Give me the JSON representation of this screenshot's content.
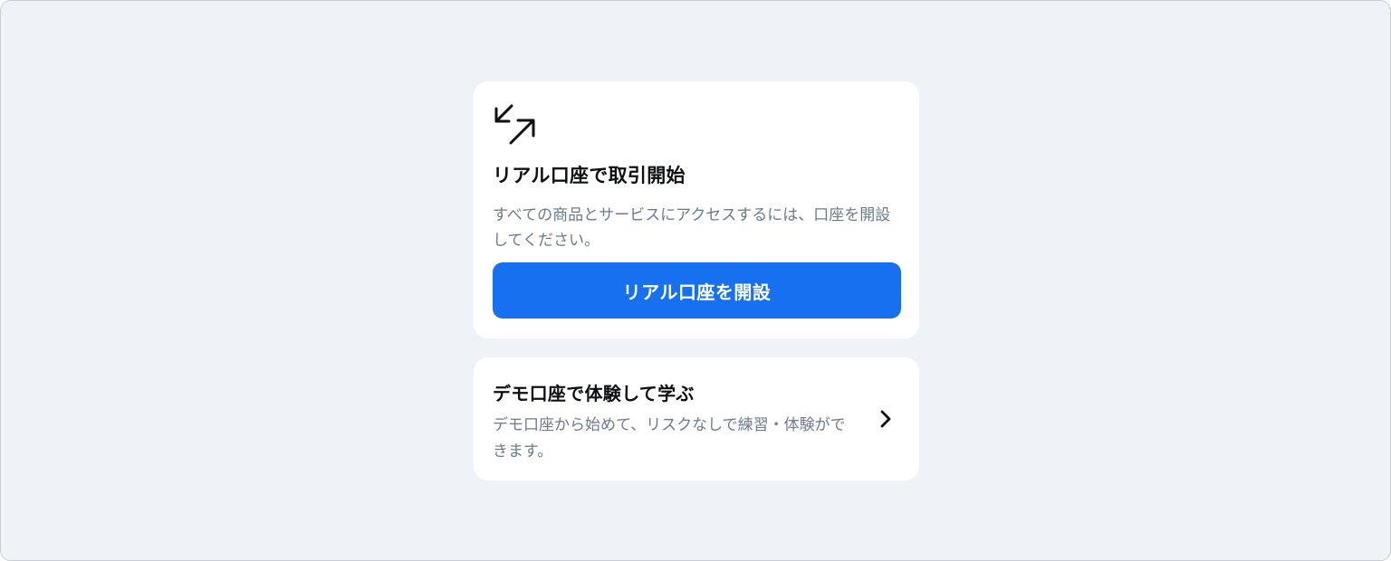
{
  "real_account": {
    "icon": "arrows-exchange-icon",
    "title": "リアル口座で取引開始",
    "description": "すべての商品とサービスにアクセスするには、口座を開設してください。",
    "button_label": "リアル口座を開設",
    "button_color": "#1670f0"
  },
  "demo_account": {
    "title": "デモ口座で体験して学ぶ",
    "description": "デモ口座から始めて、リスクなしで練習・体験ができます。",
    "icon": "chevron-right-icon"
  },
  "colors": {
    "background": "#eff3f8",
    "card": "#ffffff",
    "title_text": "#0d0f12",
    "secondary_text": "#6d7a8c"
  }
}
